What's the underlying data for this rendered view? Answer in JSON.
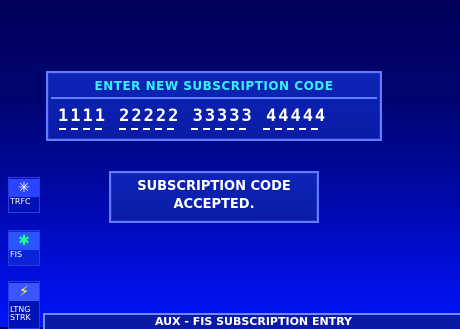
{
  "entry": {
    "title": "ENTER NEW SUBSCRIPTION CODE",
    "code": "1111 22222 33333 44444"
  },
  "message": {
    "line1": "SUBSCRIPTION CODE",
    "line2": "ACCEPTED."
  },
  "sidebar": {
    "items": [
      {
        "label": "TRFC",
        "icon": "traffic-icon"
      },
      {
        "label": "FIS",
        "icon": "fis-weather-icon"
      },
      {
        "label": "LTNG STRK",
        "icon": "lightning-icon"
      }
    ]
  },
  "status_bar": {
    "title": "AUX - FIS SUBSCRIPTION ENTRY"
  },
  "colors": {
    "title_cyan": "#36f0ff",
    "panel_border": "#5f7dff",
    "text_white": "#ffffff"
  }
}
